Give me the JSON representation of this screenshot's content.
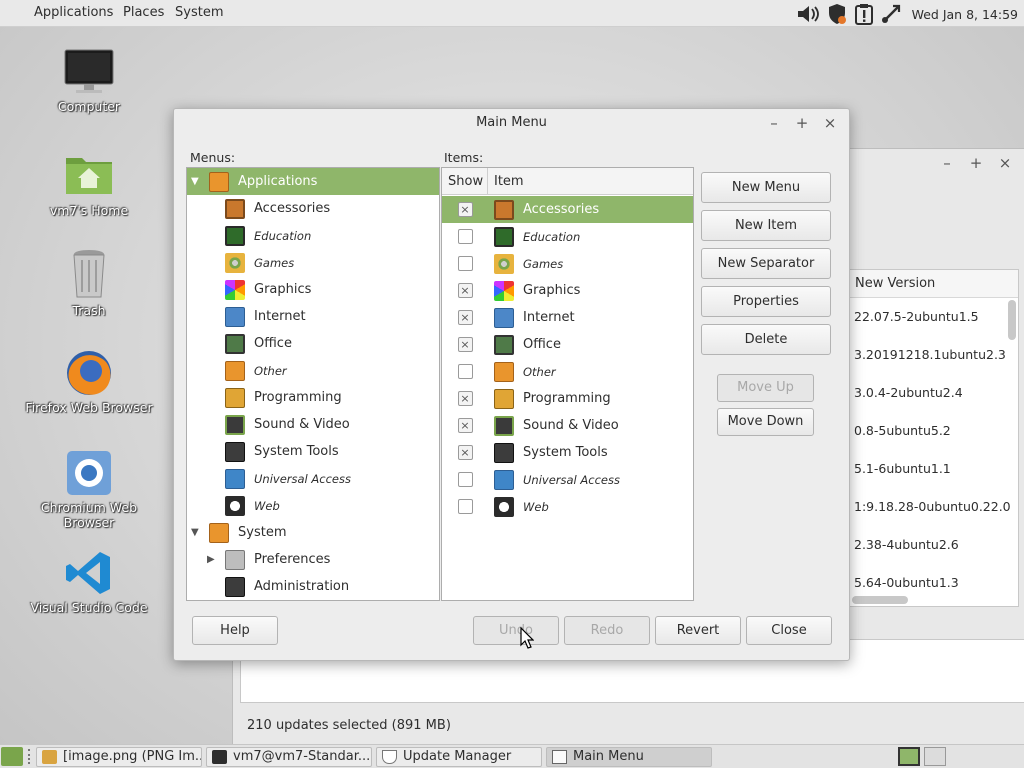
{
  "top_panel": {
    "menus": [
      "Applications",
      "Places",
      "System"
    ],
    "clock": "Wed Jan 8, 14:59",
    "tray_icons": [
      "volume-icon",
      "shield-update-icon",
      "clipboard-alert-icon",
      "network-icon"
    ]
  },
  "desktop_icons": [
    {
      "label": "Computer",
      "icon": "monitor-icon"
    },
    {
      "label": "vm7's Home",
      "icon": "home-folder-icon"
    },
    {
      "label": "Trash",
      "icon": "trash-icon"
    },
    {
      "label": "Firefox Web Browser",
      "icon": "firefox-icon"
    },
    {
      "label": "Chromium Web Browser",
      "icon": "chromium-icon"
    },
    {
      "label": "Visual Studio Code",
      "icon": "vscode-icon"
    }
  ],
  "update_manager": {
    "column_header": "New Version",
    "versions": [
      "22.07.5-2ubuntu1.5",
      "3.20191218.1ubuntu2.3",
      "3.0.4-2ubuntu2.4",
      "0.8-5ubuntu5.2",
      "5.1-6ubuntu1.1",
      "1:9.18.28-0ubuntu0.22.0",
      "2.38-4ubuntu2.6",
      "5.64-0ubuntu1.3"
    ],
    "status": "210 updates selected (891 MB)"
  },
  "dialog": {
    "title": "Main Menu",
    "menus_label": "Menus:",
    "items_label": "Items:",
    "col_show": "Show",
    "col_item": "Item",
    "tree": [
      {
        "label": "Applications",
        "level": 0,
        "expanded": true,
        "selected": true,
        "italic": false
      },
      {
        "label": "Accessories",
        "level": 1,
        "italic": false
      },
      {
        "label": "Education",
        "level": 1,
        "italic": true
      },
      {
        "label": "Games",
        "level": 1,
        "italic": true
      },
      {
        "label": "Graphics",
        "level": 1,
        "italic": false
      },
      {
        "label": "Internet",
        "level": 1,
        "italic": false
      },
      {
        "label": "Office",
        "level": 1,
        "italic": false
      },
      {
        "label": "Other",
        "level": 1,
        "italic": true
      },
      {
        "label": "Programming",
        "level": 1,
        "italic": false
      },
      {
        "label": "Sound & Video",
        "level": 1,
        "italic": false
      },
      {
        "label": "System Tools",
        "level": 1,
        "italic": false
      },
      {
        "label": "Universal Access",
        "level": 1,
        "italic": true
      },
      {
        "label": "Web",
        "level": 1,
        "italic": true
      },
      {
        "label": "System",
        "level": 0,
        "expanded": true,
        "italic": false
      },
      {
        "label": "Preferences",
        "level": 1,
        "collapsed_child": true,
        "italic": false
      },
      {
        "label": "Administration",
        "level": 1,
        "italic": false
      }
    ],
    "items": [
      {
        "label": "Accessories",
        "show": true,
        "selected": true,
        "italic": false
      },
      {
        "label": "Education",
        "show": false,
        "italic": true
      },
      {
        "label": "Games",
        "show": false,
        "italic": true
      },
      {
        "label": "Graphics",
        "show": true,
        "italic": false
      },
      {
        "label": "Internet",
        "show": true,
        "italic": false
      },
      {
        "label": "Office",
        "show": true,
        "italic": false
      },
      {
        "label": "Other",
        "show": false,
        "italic": true
      },
      {
        "label": "Programming",
        "show": true,
        "italic": false
      },
      {
        "label": "Sound & Video",
        "show": true,
        "italic": false
      },
      {
        "label": "System Tools",
        "show": true,
        "italic": false
      },
      {
        "label": "Universal Access",
        "show": false,
        "italic": true
      },
      {
        "label": "Web",
        "show": false,
        "italic": true
      }
    ],
    "side_buttons": {
      "new_menu": "New Menu",
      "new_item": "New Item",
      "new_separator": "New Separator",
      "properties": "Properties",
      "delete": "Delete",
      "move_up": "Move Up",
      "move_down": "Move Down"
    },
    "bottom_buttons": {
      "help": "Help",
      "undo": "Undo",
      "redo": "Redo",
      "revert": "Revert",
      "close": "Close"
    }
  },
  "taskbar": {
    "tasks": [
      "[image.png (PNG Im...",
      "vm7@vm7-Standar...",
      "Update Manager",
      "Main Menu"
    ]
  },
  "colors": {
    "selection": "#8fb66a",
    "mint_green": "#7aa54b"
  }
}
